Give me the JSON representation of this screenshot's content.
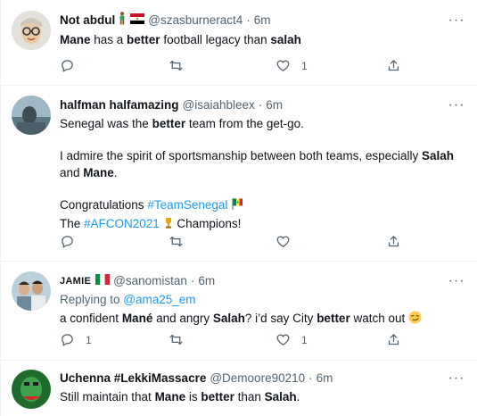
{
  "tweets": [
    {
      "name": "Not abdul",
      "handle": "@szasburneract4",
      "dot": "·",
      "time": "6m",
      "segments": [
        {
          "t": "Mane",
          "b": true
        },
        {
          "t": " has a "
        },
        {
          "t": "better",
          "b": true
        },
        {
          "t": " football legacy than "
        },
        {
          "t": "salah",
          "b": true
        }
      ],
      "reply_count": "",
      "retweet_count": "",
      "like_count": "1"
    },
    {
      "name": "halfman halfamazing",
      "handle": "@isaiahbleex",
      "dot": "·",
      "time": "6m",
      "para1": [
        {
          "t": "Senegal was the "
        },
        {
          "t": "better",
          "b": true
        },
        {
          "t": " team from the get-go."
        }
      ],
      "para2": [
        {
          "t": "I admire the spirit of sportsmanship between both teams, especially "
        },
        {
          "t": "Salah",
          "b": true
        },
        {
          "t": " and "
        },
        {
          "t": "Mane",
          "b": true
        },
        {
          "t": "."
        }
      ],
      "congrats": "Congratulations ",
      "hashtag1": "#TeamSenegal",
      "the": "The ",
      "hashtag2": "#AFCON2021",
      "champions": " Champions!",
      "reply_count": "",
      "retweet_count": "",
      "like_count": ""
    },
    {
      "name": "JAMIE",
      "handle": "@sanomistan",
      "dot": "·",
      "time": "6m",
      "replying_label": "Replying to ",
      "replying_handle": "@ama25_em",
      "segments": [
        {
          "t": "a confident "
        },
        {
          "t": "Mané",
          "b": true
        },
        {
          "t": " and angry "
        },
        {
          "t": "Salah",
          "b": true
        },
        {
          "t": "? i’d say City "
        },
        {
          "t": "better",
          "b": true
        },
        {
          "t": " watch out "
        }
      ],
      "reply_count": "1",
      "retweet_count": "",
      "like_count": "1"
    },
    {
      "name": "Uchenna #LekkiMassacre",
      "handle": "@Demoore90210",
      "dot": "·",
      "time": "6m",
      "segments": [
        {
          "t": "Still maintain that "
        },
        {
          "t": "Mane",
          "b": true
        },
        {
          "t": " is "
        },
        {
          "t": "better",
          "b": true
        },
        {
          "t": " than "
        },
        {
          "t": "Salah",
          "b": true
        },
        {
          "t": "."
        }
      ]
    }
  ],
  "more_glyph": "···",
  "colors": {
    "text": "#0f1419",
    "secondary": "#536471",
    "link": "#1d9bf0",
    "divider": "#eff3f4"
  },
  "icons": [
    "reply-icon",
    "retweet-icon",
    "like-icon",
    "share-icon",
    "more-icon"
  ]
}
